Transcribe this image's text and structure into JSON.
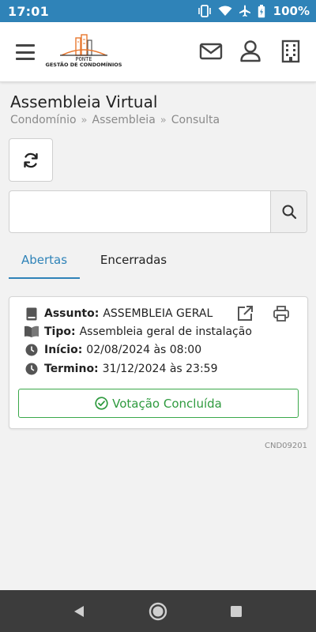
{
  "status_bar": {
    "time": "17:01",
    "battery": "100%",
    "icons": [
      "vibrate-icon",
      "wifi-icon",
      "airplane-icon",
      "battery-icon"
    ]
  },
  "header": {
    "logo_word": "PONTE",
    "logo_sub": "GESTÃO DE CONDOMÍNIOS",
    "icons": [
      "menu-icon",
      "mail-icon",
      "user-icon",
      "building-icon"
    ]
  },
  "page": {
    "title": "Assembleia Virtual",
    "breadcrumb": [
      "Condomínio",
      "Assembleia",
      "Consulta"
    ]
  },
  "search": {
    "value": "",
    "placeholder": ""
  },
  "tabs": [
    {
      "label": "Abertas",
      "active": true
    },
    {
      "label": "Encerradas",
      "active": false
    }
  ],
  "card": {
    "assunto_label": "Assunto:",
    "assunto_value": "ASSEMBLEIA GERAL",
    "tipo_label": "Tipo:",
    "tipo_value": "Assembleia geral de instalação",
    "inicio_label": "Início:",
    "inicio_value": "02/08/2024 às 08:00",
    "termino_label": "Termino:",
    "termino_value": "31/12/2024 às 23:59",
    "vote_button": "Votação Concluída"
  },
  "footer_code": "CND09201",
  "colors": {
    "status_bar": "#2f83b8",
    "accent": "#2f83b8",
    "success": "#2e9a3e",
    "nav_bar": "#3c3c3c"
  }
}
